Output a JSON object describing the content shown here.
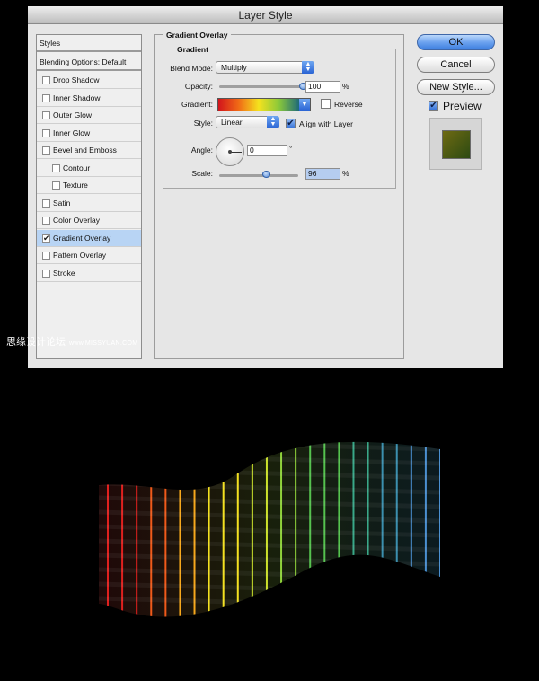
{
  "window": {
    "title": "Layer Style"
  },
  "sidebar": {
    "header": "Styles",
    "blending": "Blending Options: Default",
    "items": [
      {
        "label": "Drop Shadow",
        "checked": false,
        "indent": false,
        "selected": false
      },
      {
        "label": "Inner Shadow",
        "checked": false,
        "indent": false,
        "selected": false
      },
      {
        "label": "Outer Glow",
        "checked": false,
        "indent": false,
        "selected": false
      },
      {
        "label": "Inner Glow",
        "checked": false,
        "indent": false,
        "selected": false
      },
      {
        "label": "Bevel and Emboss",
        "checked": false,
        "indent": false,
        "selected": false
      },
      {
        "label": "Contour",
        "checked": false,
        "indent": true,
        "selected": false
      },
      {
        "label": "Texture",
        "checked": false,
        "indent": true,
        "selected": false
      },
      {
        "label": "Satin",
        "checked": false,
        "indent": false,
        "selected": false
      },
      {
        "label": "Color Overlay",
        "checked": false,
        "indent": false,
        "selected": false
      },
      {
        "label": "Gradient Overlay",
        "checked": true,
        "indent": false,
        "selected": true
      },
      {
        "label": "Pattern Overlay",
        "checked": false,
        "indent": false,
        "selected": false
      },
      {
        "label": "Stroke",
        "checked": false,
        "indent": false,
        "selected": false
      }
    ]
  },
  "panel": {
    "section_title": "Gradient Overlay",
    "group_title": "Gradient",
    "blend_mode_label": "Blend Mode:",
    "blend_mode_value": "Multiply",
    "opacity_label": "Opacity:",
    "opacity_value": "100",
    "opacity_level": 1.0,
    "gradient_label": "Gradient:",
    "gradient_colors": [
      "#d2141c",
      "#f06a16",
      "#f4e21e",
      "#8ac83a",
      "#1e6a78"
    ],
    "reverse_label": "Reverse",
    "reverse_checked": false,
    "style_label": "Style:",
    "style_value": "Linear",
    "align_label": "Align with Layer",
    "align_checked": true,
    "angle_label": "Angle:",
    "angle_value": "0",
    "angle_unit": "°",
    "scale_label": "Scale:",
    "scale_value": "96",
    "scale_level": 0.6,
    "percent": "%"
  },
  "buttons": {
    "ok": "OK",
    "cancel": "Cancel",
    "new_style": "New Style...",
    "preview": "Preview",
    "preview_checked": true
  },
  "watermark": {
    "text": "思缘设计论坛",
    "url": "www.MISSYUAN.COM"
  },
  "artwork": {
    "stripe_colors": [
      "#e0201e",
      "#f05a1a",
      "#f7a81c",
      "#f4e11f",
      "#cbe12a",
      "#8fd33a",
      "#55c24e",
      "#39a888",
      "#3b8fae",
      "#4a8fd0"
    ]
  }
}
